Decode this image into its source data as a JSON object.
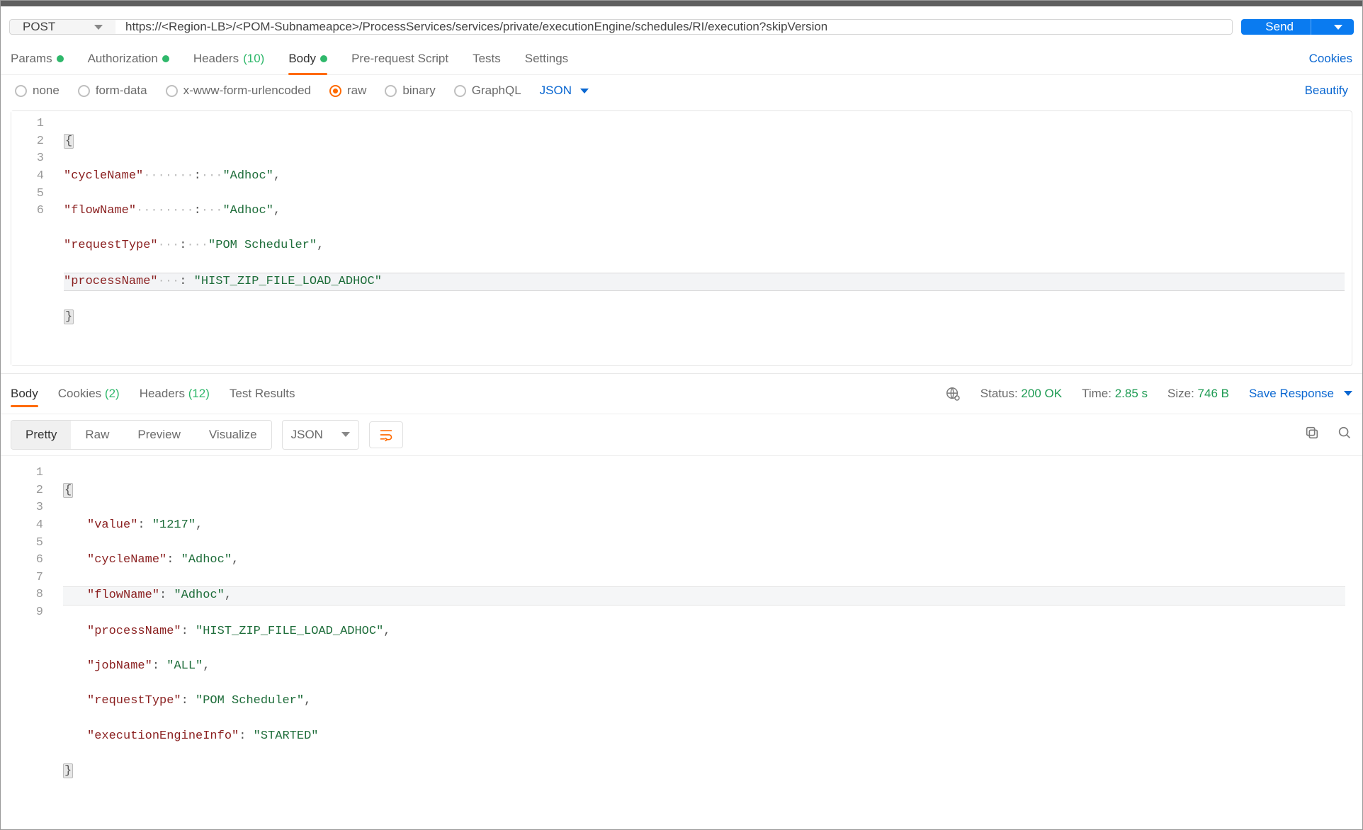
{
  "request": {
    "method": "POST",
    "url": "https://<Region-LB>/<POM-Subnameapce>/ProcessServices/services/private/executionEngine/schedules/RI/execution?skipVersion",
    "send_label": "Send"
  },
  "tabs": {
    "params": "Params",
    "authorization": "Authorization",
    "headers": "Headers",
    "headers_count": "(10)",
    "body": "Body",
    "pre_request": "Pre-request Script",
    "tests": "Tests",
    "settings": "Settings",
    "cookies": "Cookies"
  },
  "body_type": {
    "none": "none",
    "form_data": "form-data",
    "x_www": "x-www-form-urlencoded",
    "raw": "raw",
    "binary": "binary",
    "graphql": "GraphQL",
    "json_dd": "JSON",
    "beautify": "Beautify"
  },
  "request_body": {
    "lines": [
      "1",
      "2",
      "3",
      "4",
      "5",
      "6"
    ],
    "json": {
      "cycleName": "Adhoc",
      "flowName": "Adhoc",
      "requestType": "POM Scheduler",
      "processName": "HIST_ZIP_FILE_LOAD_ADHOC"
    }
  },
  "response_tabs": {
    "body": "Body",
    "cookies": "Cookies",
    "cookies_count": "(2)",
    "headers": "Headers",
    "headers_count": "(12)",
    "test_results": "Test Results",
    "status_label": "Status:",
    "status_value": "200 OK",
    "time_label": "Time:",
    "time_value": "2.85 s",
    "size_label": "Size:",
    "size_value": "746 B",
    "save_response": "Save Response"
  },
  "response_toolbar": {
    "pretty": "Pretty",
    "raw": "Raw",
    "preview": "Preview",
    "visualize": "Visualize",
    "json_dd": "JSON"
  },
  "response_body": {
    "lines": [
      "1",
      "2",
      "3",
      "4",
      "5",
      "6",
      "7",
      "8",
      "9"
    ],
    "json": {
      "value": "1217",
      "cycleName": "Adhoc",
      "flowName": "Adhoc",
      "processName": "HIST_ZIP_FILE_LOAD_ADHOC",
      "jobName": "ALL",
      "requestType": "POM Scheduler",
      "executionEngineInfo": "STARTED"
    }
  }
}
